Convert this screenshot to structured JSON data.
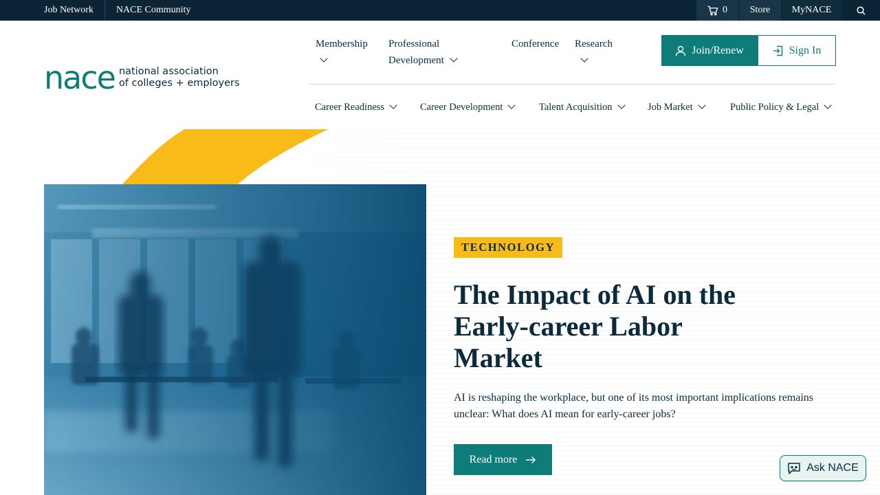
{
  "topbar": {
    "job_network": "Job Network",
    "community": "NACE Community",
    "cart_count": "0",
    "store": "Store",
    "my_nace": "MyNACE"
  },
  "logo": {
    "mark": "nace",
    "line1": "national association",
    "line2": "of colleges + employers"
  },
  "primary_nav": {
    "membership": "Membership",
    "prof_dev_line1": "Professional",
    "prof_dev_line2": "Development",
    "conference": "Conference",
    "research": "Research"
  },
  "account": {
    "join": "Join/Renew",
    "sign_in": "Sign In"
  },
  "secondary_nav": {
    "career_readiness": "Career Readiness",
    "career_development": "Career Development",
    "talent_acquisition": "Talent Acquisition",
    "job_market": "Job Market",
    "public_policy": "Public Policy & Legal"
  },
  "hero": {
    "tag": "TECHNOLOGY",
    "headline": "The Impact of AI on the Early-career Labor Market",
    "summary": "AI is reshaping the workplace, but one of its most important implications remains unclear: What does AI mean for early-career jobs?",
    "read_more": "Read more"
  },
  "assistant": {
    "label": "Ask NACE"
  },
  "colors": {
    "navy": "#0b2537",
    "teal": "#0e7d7a",
    "yellow": "#f8bb17"
  }
}
